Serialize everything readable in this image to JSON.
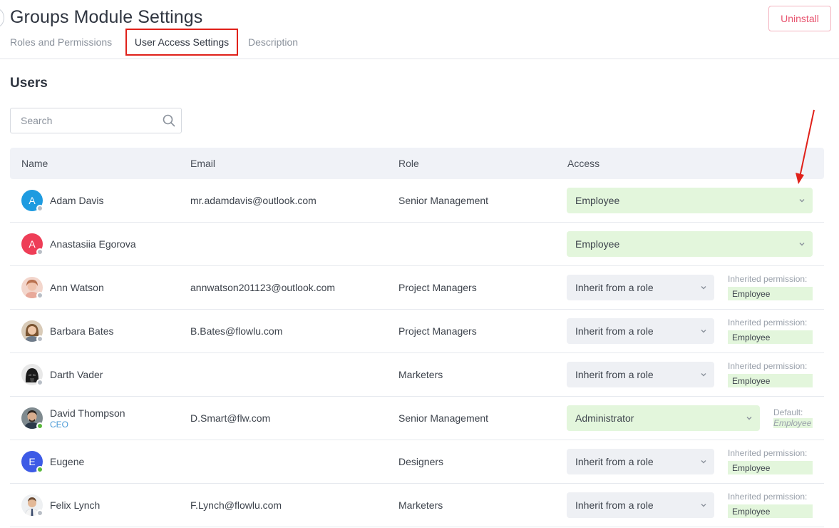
{
  "header": {
    "title": "Groups Module Settings",
    "uninstall_label": "Uninstall",
    "tabs": [
      {
        "label": "Roles and Permissions"
      },
      {
        "label": "User Access Settings"
      },
      {
        "label": "Description"
      }
    ]
  },
  "users_section": {
    "title": "Users",
    "search_placeholder": "Search"
  },
  "table": {
    "columns": {
      "name": "Name",
      "email": "Email",
      "role": "Role",
      "access": "Access"
    },
    "rows": [
      {
        "name": "Adam Davis",
        "subtitle": "",
        "email": "mr.adamdavis@outlook.com",
        "role": "Senior Management",
        "access": "Employee",
        "initial": "A",
        "avatar_color": "#1e9be0",
        "online": false
      },
      {
        "name": "Anastasiia Egorova",
        "subtitle": "",
        "email": "",
        "role": "",
        "access": "Employee",
        "initial": "A",
        "avatar_color": "#ee3e57",
        "online": false
      },
      {
        "name": "Ann Watson",
        "subtitle": "",
        "email": "annwatson201123@outlook.com",
        "role": "Project Managers",
        "access": "Inherit from a role",
        "inherited_label": "Inherited permission:",
        "inherited_value": "Employee",
        "online": false
      },
      {
        "name": "Barbara Bates",
        "subtitle": "",
        "email": "B.Bates@flowlu.com",
        "role": "Project Managers",
        "access": "Inherit from a role",
        "inherited_label": "Inherited permission:",
        "inherited_value": "Employee",
        "online": false
      },
      {
        "name": "Darth Vader",
        "subtitle": "",
        "email": "",
        "role": "Marketers",
        "access": "Inherit from a role",
        "inherited_label": "Inherited permission:",
        "inherited_value": "Employee",
        "online": false
      },
      {
        "name": "David Thompson",
        "subtitle": "CEO",
        "email": "D.Smart@flw.com",
        "role": "Senior Management",
        "access": "Administrator",
        "default_label": "Default:",
        "default_value": "Employee",
        "online": true
      },
      {
        "name": "Eugene",
        "subtitle": "",
        "email": "",
        "role": "Designers",
        "access": "Inherit from a role",
        "inherited_label": "Inherited permission:",
        "inherited_value": "Employee",
        "initial": "E",
        "avatar_color": "#3d5be6",
        "online": true
      },
      {
        "name": "Felix Lynch",
        "subtitle": "",
        "email": "F.Lynch@flowlu.com",
        "role": "Marketers",
        "access": "Inherit from a role",
        "inherited_label": "Inherited permission:",
        "inherited_value": "Employee",
        "online": false
      }
    ]
  },
  "colors": {
    "accent_red": "#e0211a",
    "access_green": "#e3f6dc",
    "access_gray": "#eef0f4",
    "uninstall": "#e8546f"
  }
}
